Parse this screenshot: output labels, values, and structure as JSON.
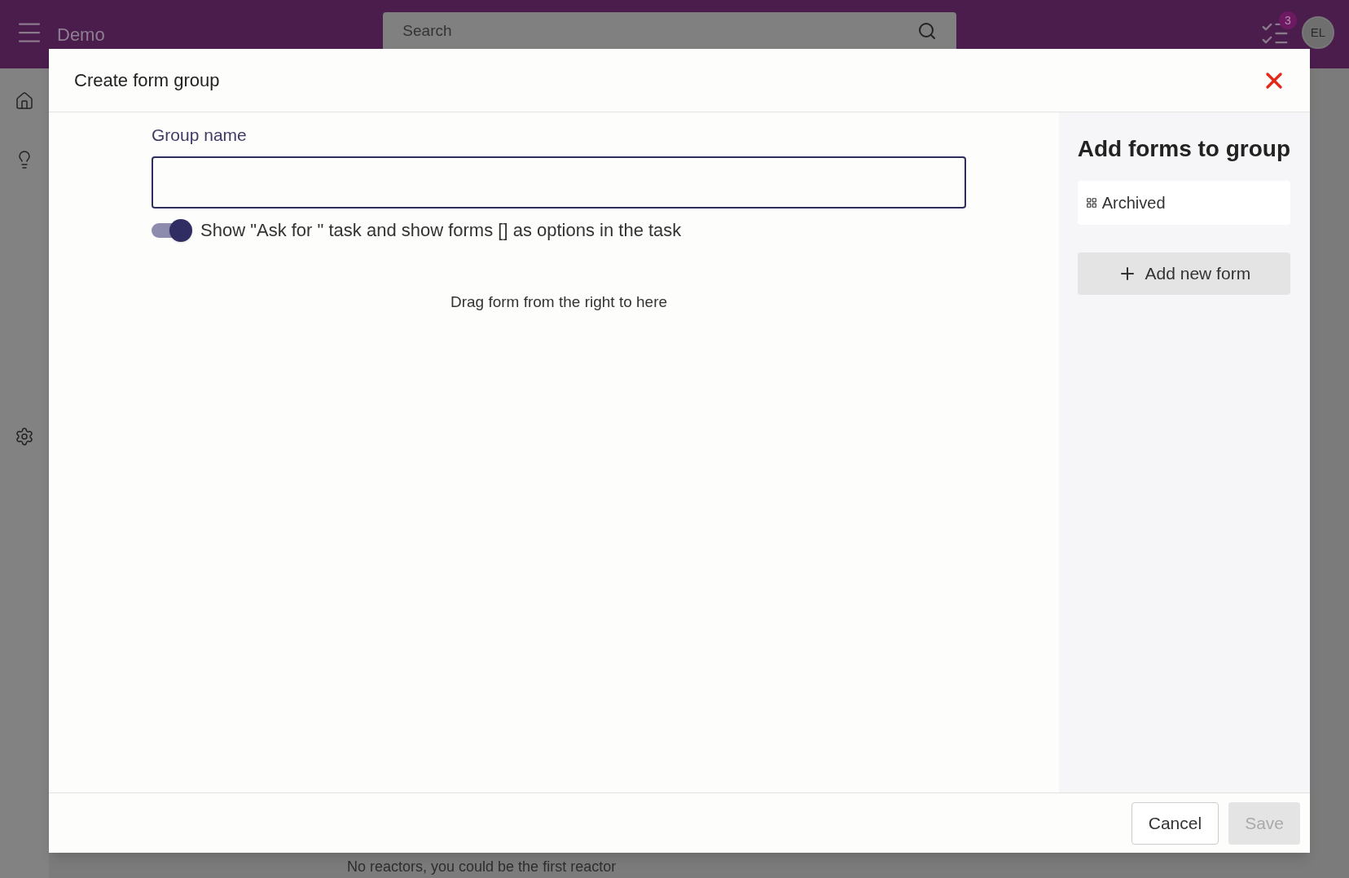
{
  "app": {
    "brand": "Demo",
    "search": {
      "placeholder": "Search"
    },
    "notification_count": "3",
    "avatar": "EL",
    "background_text": "No reactors, you could be the first reactor"
  },
  "dialog": {
    "title": "Create form group",
    "group_name": {
      "label": "Group name"
    },
    "toggle": {
      "label": "Show \"Ask for \" task and show forms [] as options in the task",
      "on": true
    },
    "drop_hint": "Drag form from the right to here",
    "side_panel": {
      "title": "Add forms to group",
      "forms": [
        {
          "name": "Archived"
        }
      ],
      "add_button": "Add new form"
    },
    "buttons": [
      {
        "label": "Cancel",
        "disabled": false
      },
      {
        "label": "Save",
        "disabled": true
      }
    ]
  }
}
